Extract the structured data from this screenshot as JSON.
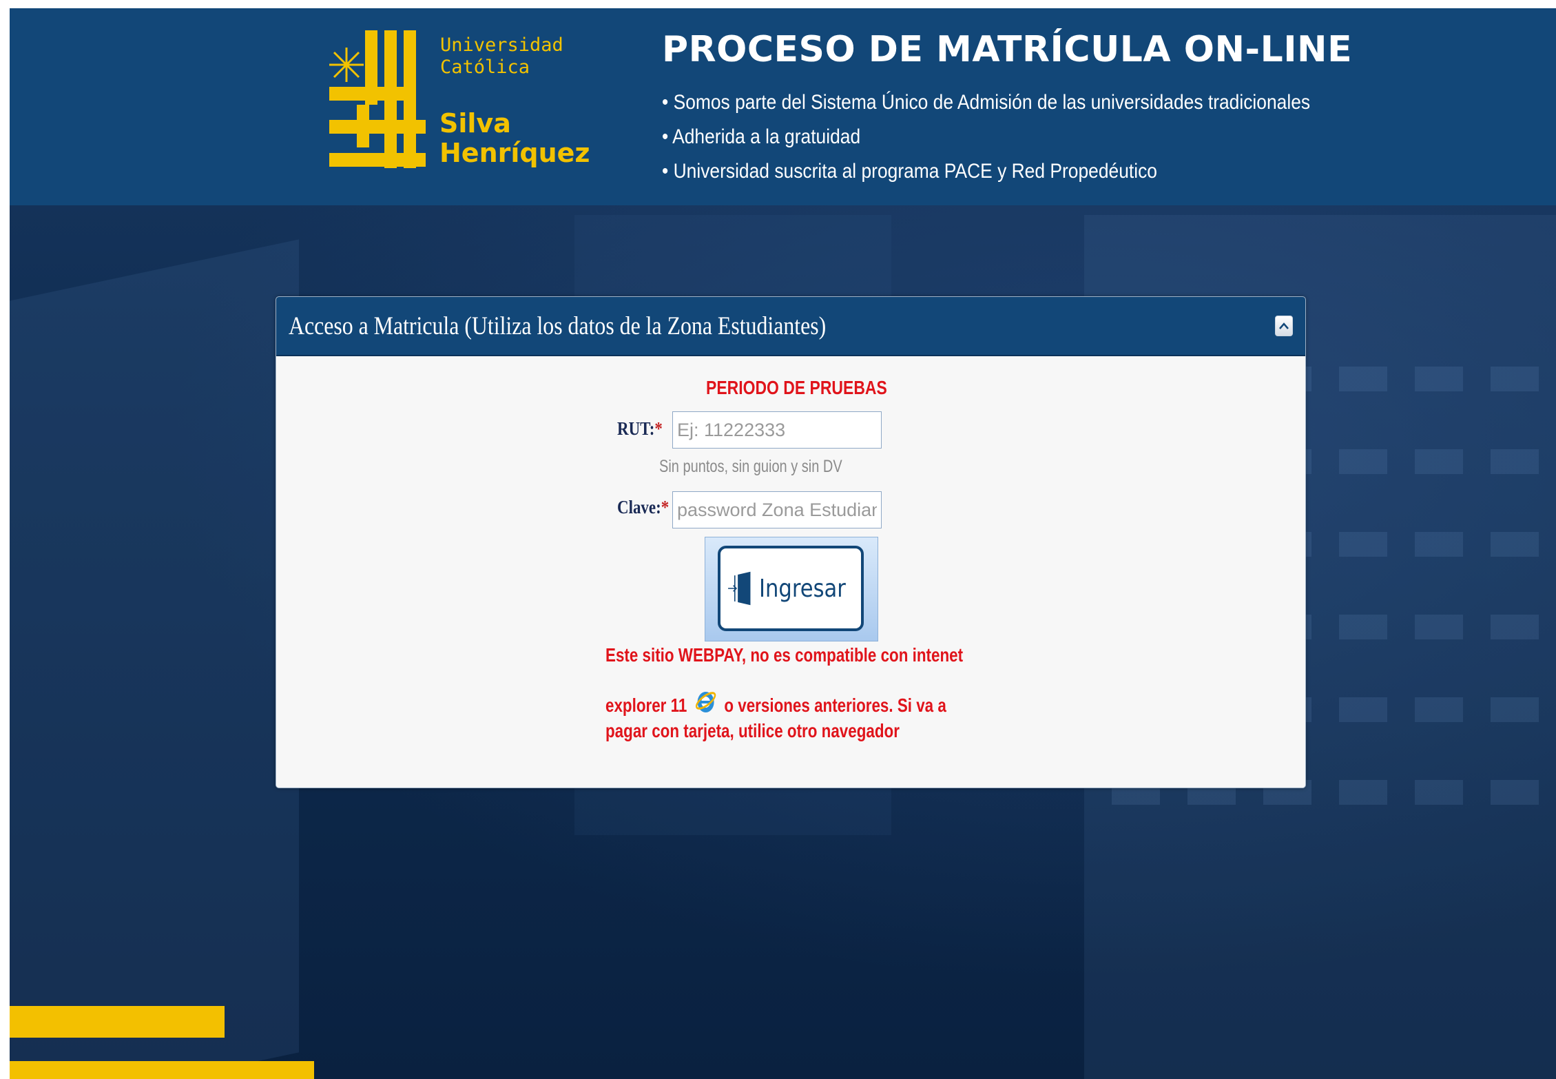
{
  "header": {
    "logo": {
      "line1": "Universidad",
      "line2": "Católica",
      "line3": "Silva",
      "line4": "Henríquez"
    },
    "title": "PROCESO DE MATRÍCULA ON-LINE",
    "bullets": [
      "Somos parte del Sistema Único de Admisión de las universidades tradicionales",
      "Adherida a la gratuidad",
      "Universidad suscrita al programa PACE y Red Propedéutico"
    ]
  },
  "panel": {
    "title": "Acceso a Matricula (Utiliza los datos de la Zona Estudiantes)",
    "notice": "PERIODO DE PRUEBAS",
    "rut": {
      "label": "RUT:",
      "required_mark": "*",
      "placeholder": "Ej: 11222333",
      "hint": "Sin puntos, sin guion y sin DV"
    },
    "clave": {
      "label": "Clave:",
      "required_mark": "*",
      "placeholder": "password Zona Estudiante"
    },
    "submit_label": "Ingresar",
    "warning": {
      "line1": "Este sitio WEBPAY, no es compatible con intenet",
      "line2a": "explorer 11",
      "line2b": "o versiones anteriores. Si va a",
      "line3": "pagar con tarjeta, utilice otro navegador"
    }
  },
  "colors": {
    "brand_blue": "#124778",
    "brand_yellow": "#f2c200",
    "alert_red": "#e0141b"
  },
  "icons": [
    "collapse-icon",
    "login-door-icon",
    "internet-explorer-icon"
  ]
}
